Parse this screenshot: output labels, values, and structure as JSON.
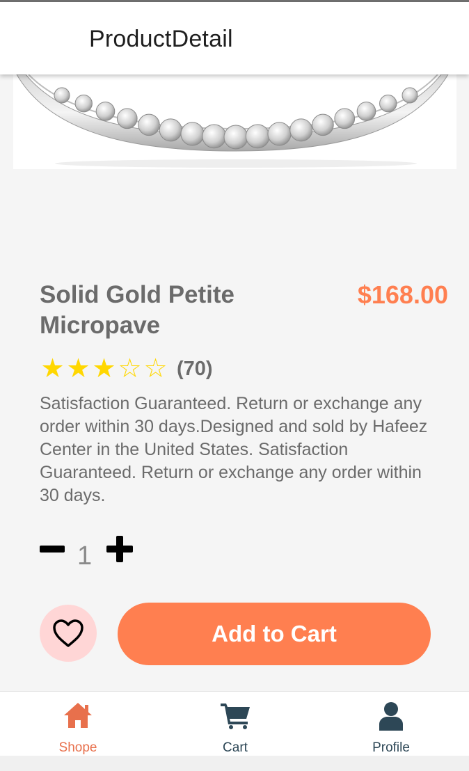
{
  "app_bar": {
    "title": "ProductDetail"
  },
  "product": {
    "name": "Solid Gold Petite Micropave",
    "price": "$168.00",
    "rating": 3,
    "rating_max": 5,
    "review_count": "(70)",
    "description": "Satisfaction Guaranteed. Return or exchange any order within 30 days.Designed and sold by Hafeez Center in the United States. Satisfaction Guaranteed. Return or exchange any order within 30 days."
  },
  "quantity": {
    "value": "1"
  },
  "actions": {
    "add_to_cart_label": "Add to Cart"
  },
  "bottom_nav": {
    "items": [
      {
        "label": "Shope",
        "icon": "home-icon",
        "active": true
      },
      {
        "label": "Cart",
        "icon": "cart-icon",
        "active": false
      },
      {
        "label": "Profile",
        "icon": "profile-icon",
        "active": false
      }
    ]
  },
  "colors": {
    "accent": "#ff7f50",
    "star": "#ffd700",
    "favorite_bg": "#ffd6d6",
    "nav_inactive": "#2d4756"
  }
}
